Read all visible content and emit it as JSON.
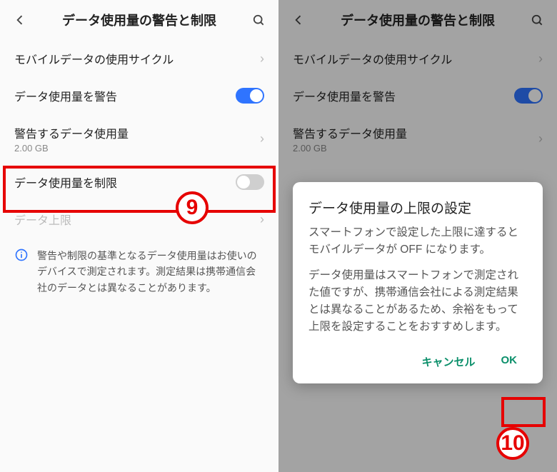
{
  "header": {
    "title": "データ使用量の警告と制限"
  },
  "rows": {
    "cycle": {
      "label": "モバイルデータの使用サイクル"
    },
    "warn": {
      "label": "データ使用量を警告"
    },
    "warnAmount": {
      "label": "警告するデータ使用量",
      "value": "2.00 GB"
    },
    "limit": {
      "label": "データ使用量を制限"
    },
    "cap": {
      "label": "データ上限"
    }
  },
  "info": {
    "text": "警告や制限の基準となるデータ使用量はお使いのデバイスで測定されます。測定結果は携帯通信会社のデータとは異なることがあります。"
  },
  "dialog": {
    "title": "データ使用量の上限の設定",
    "body1": "スマートフォンで設定した上限に達するとモバイルデータが OFF になります。",
    "body2": "データ使用量はスマートフォンで測定された値ですが、携帯通信会社による測定結果とは異なることがあるため、余裕をもって上限を設定することをおすすめします。",
    "cancel": "キャンセル",
    "ok": "OK"
  },
  "callouts": {
    "nine": "9",
    "ten": "10"
  }
}
